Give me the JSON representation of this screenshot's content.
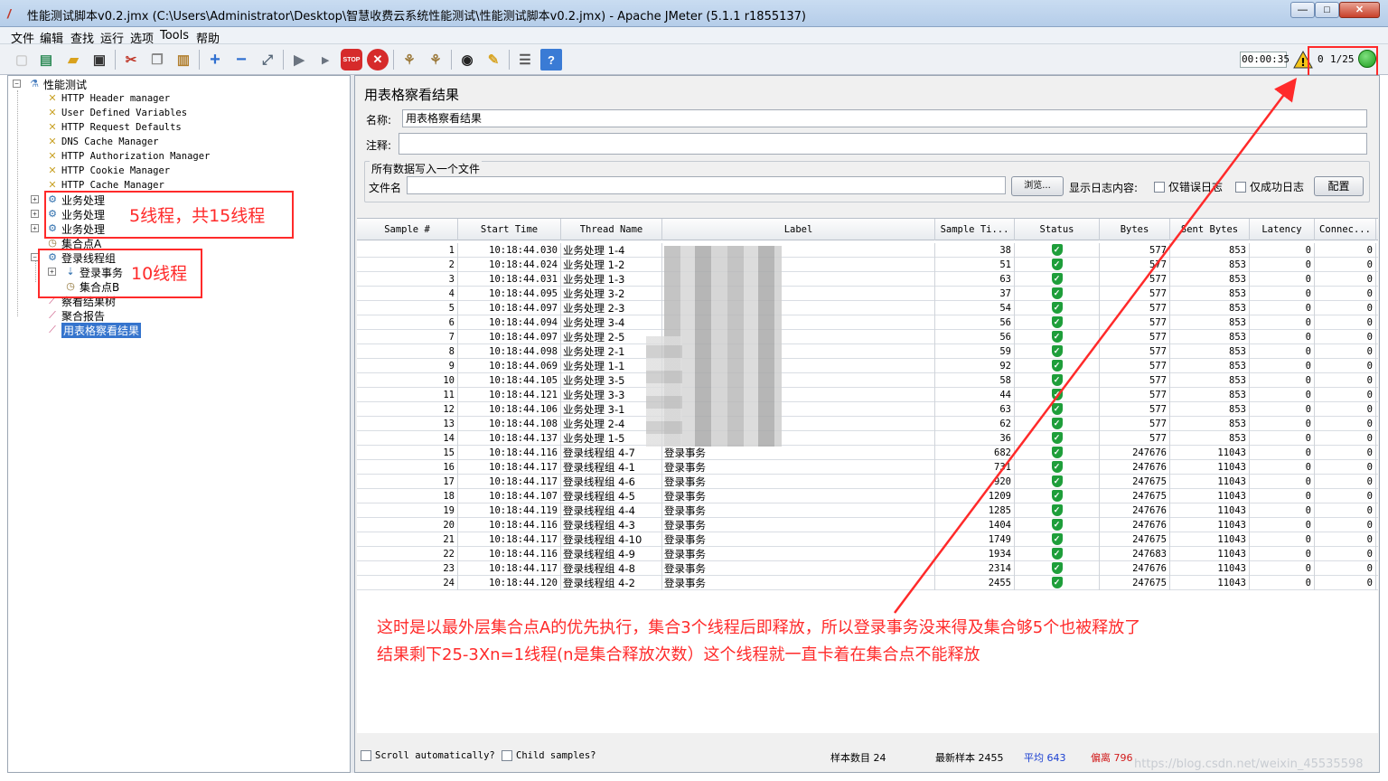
{
  "window": {
    "title": "性能测试脚本v0.2.jmx (C:\\Users\\Administrator\\Desktop\\智慧收费云系统性能测试\\性能测试脚本v0.2.jmx) - Apache JMeter (5.1.1 r1855137)",
    "min": "—",
    "max": "□",
    "close": "✕"
  },
  "menu": [
    "文件",
    "编辑",
    "查找",
    "运行",
    "选项",
    "Tools",
    "帮助"
  ],
  "toolbar": {
    "timer": "00:00:35",
    "error_count": "0",
    "threads": "1/25",
    "icons": [
      "new-icon",
      "templates-icon",
      "open-icon",
      "save-icon",
      "cut-icon",
      "copy-icon",
      "paste-icon",
      "expand-icon",
      "collapse-icon",
      "toggle-icon",
      "start-icon",
      "start-no-pause-icon",
      "stop-icon",
      "shutdown-icon",
      "clear-icon",
      "clear-all-icon",
      "search-icon",
      "reset-search-icon",
      "function-helper-icon",
      "help-icon"
    ]
  },
  "tree": {
    "nodes": [
      {
        "label": "性能测试",
        "icon": "testplan-icon"
      },
      {
        "label": "HTTP Header manager",
        "icon": "wrench-icon"
      },
      {
        "label": "User Defined Variables",
        "icon": "wrench-icon"
      },
      {
        "label": "HTTP Request Defaults",
        "icon": "wrench-icon"
      },
      {
        "label": "DNS Cache Manager",
        "icon": "wrench-icon"
      },
      {
        "label": "HTTP Authorization Manager",
        "icon": "wrench-icon"
      },
      {
        "label": "HTTP Cookie Manager",
        "icon": "wrench-icon"
      },
      {
        "label": "HTTP Cache Manager",
        "icon": "wrench-icon"
      },
      {
        "label": "业务处理",
        "icon": "thread-group-icon"
      },
      {
        "label": "业务处理",
        "icon": "thread-group-icon"
      },
      {
        "label": "业务处理",
        "icon": "thread-group-icon"
      },
      {
        "label": "集合点A",
        "icon": "timer-icon"
      },
      {
        "label": "登录线程组",
        "icon": "thread-group-icon"
      },
      {
        "label": "登录事务",
        "icon": "transaction-icon"
      },
      {
        "label": "集合点B",
        "icon": "timer-icon"
      },
      {
        "label": "察看结果树",
        "icon": "listener-icon"
      },
      {
        "label": "聚合报告",
        "icon": "listener-icon"
      },
      {
        "label": "用表格察看结果",
        "icon": "listener-icon"
      }
    ]
  },
  "annotations": {
    "box1": "5线程，共15线程",
    "box2": "10线程",
    "note_line1": "这时是以最外层集合点A的优先执行，集合3个线程后即释放，所以登录事务没来得及集合够5个也被释放了",
    "note_line2": "结果剩下25-3Xn=1线程(n是集合释放次数）这个线程就一直卡着在集合点不能释放"
  },
  "panel": {
    "title": "用表格察看结果",
    "name_label": "名称:",
    "name_value": "用表格察看结果",
    "comment_label": "注释:",
    "comment_value": "",
    "file_group_title": "所有数据写入一个文件",
    "filename_label": "文件名",
    "filename_value": "",
    "browse_label": "浏览...",
    "log_label": "显示日志内容:",
    "errors_only": "仅错误日志",
    "success_only": "仅成功日志",
    "configure": "配置"
  },
  "table": {
    "columns": [
      "Sample #",
      "Start Time",
      "Thread Name",
      "Label",
      "Sample Ti...",
      "Status",
      "Bytes",
      "Sent Bytes",
      "Latency",
      "Connec..."
    ],
    "rows": [
      [
        "1",
        "10:18:44.030",
        "业务处理 1-4",
        "",
        "38",
        "ok",
        "577",
        "853",
        "0",
        "0"
      ],
      [
        "2",
        "10:18:44.024",
        "业务处理 1-2",
        "",
        "51",
        "ok",
        "577",
        "853",
        "0",
        "0"
      ],
      [
        "3",
        "10:18:44.031",
        "业务处理 1-3",
        "",
        "63",
        "ok",
        "577",
        "853",
        "0",
        "0"
      ],
      [
        "4",
        "10:18:44.095",
        "业务处理 3-2",
        "",
        "37",
        "ok",
        "577",
        "853",
        "0",
        "0"
      ],
      [
        "5",
        "10:18:44.097",
        "业务处理 2-3",
        "",
        "54",
        "ok",
        "577",
        "853",
        "0",
        "0"
      ],
      [
        "6",
        "10:18:44.094",
        "业务处理 3-4",
        "",
        "56",
        "ok",
        "577",
        "853",
        "0",
        "0"
      ],
      [
        "7",
        "10:18:44.097",
        "业务处理 2-5",
        "",
        "56",
        "ok",
        "577",
        "853",
        "0",
        "0"
      ],
      [
        "8",
        "10:18:44.098",
        "业务处理 2-1",
        "",
        "59",
        "ok",
        "577",
        "853",
        "0",
        "0"
      ],
      [
        "9",
        "10:18:44.069",
        "业务处理 1-1",
        "",
        "92",
        "ok",
        "577",
        "853",
        "0",
        "0"
      ],
      [
        "10",
        "10:18:44.105",
        "业务处理 3-5",
        "",
        "58",
        "ok",
        "577",
        "853",
        "0",
        "0"
      ],
      [
        "11",
        "10:18:44.121",
        "业务处理 3-3",
        "",
        "44",
        "ok",
        "577",
        "853",
        "0",
        "0"
      ],
      [
        "12",
        "10:18:44.106",
        "业务处理 3-1",
        "",
        "63",
        "ok",
        "577",
        "853",
        "0",
        "0"
      ],
      [
        "13",
        "10:18:44.108",
        "业务处理 2-4",
        "",
        "62",
        "ok",
        "577",
        "853",
        "0",
        "0"
      ],
      [
        "14",
        "10:18:44.137",
        "业务处理 1-5",
        "",
        "36",
        "ok",
        "577",
        "853",
        "0",
        "0"
      ],
      [
        "15",
        "10:18:44.116",
        "登录线程组 4-7",
        "登录事务",
        "682",
        "ok",
        "247676",
        "11043",
        "0",
        "0"
      ],
      [
        "16",
        "10:18:44.117",
        "登录线程组 4-1",
        "登录事务",
        "731",
        "ok",
        "247676",
        "11043",
        "0",
        "0"
      ],
      [
        "17",
        "10:18:44.117",
        "登录线程组 4-6",
        "登录事务",
        "920",
        "ok",
        "247675",
        "11043",
        "0",
        "0"
      ],
      [
        "18",
        "10:18:44.107",
        "登录线程组 4-5",
        "登录事务",
        "1209",
        "ok",
        "247675",
        "11043",
        "0",
        "0"
      ],
      [
        "19",
        "10:18:44.119",
        "登录线程组 4-4",
        "登录事务",
        "1285",
        "ok",
        "247676",
        "11043",
        "0",
        "0"
      ],
      [
        "20",
        "10:18:44.116",
        "登录线程组 4-3",
        "登录事务",
        "1404",
        "ok",
        "247676",
        "11043",
        "0",
        "0"
      ],
      [
        "21",
        "10:18:44.117",
        "登录线程组 4-10",
        "登录事务",
        "1749",
        "ok",
        "247675",
        "11043",
        "0",
        "0"
      ],
      [
        "22",
        "10:18:44.116",
        "登录线程组 4-9",
        "登录事务",
        "1934",
        "ok",
        "247683",
        "11043",
        "0",
        "0"
      ],
      [
        "23",
        "10:18:44.117",
        "登录线程组 4-8",
        "登录事务",
        "2314",
        "ok",
        "247676",
        "11043",
        "0",
        "0"
      ],
      [
        "24",
        "10:18:44.120",
        "登录线程组 4-2",
        "登录事务",
        "2455",
        "ok",
        "247675",
        "11043",
        "0",
        "0"
      ]
    ]
  },
  "status": {
    "scroll_auto": "Scroll automatically?",
    "child_samples": "Child samples?",
    "sample_count": "样本数目 24",
    "latest_sample": "最新样本 2455",
    "average": "平均 643",
    "deviation": "偏离 796",
    "average_color": "#1a3fd1",
    "deviation_color": "#d11a1a"
  },
  "watermark": "https://blog.csdn.net/weixin_45535598"
}
